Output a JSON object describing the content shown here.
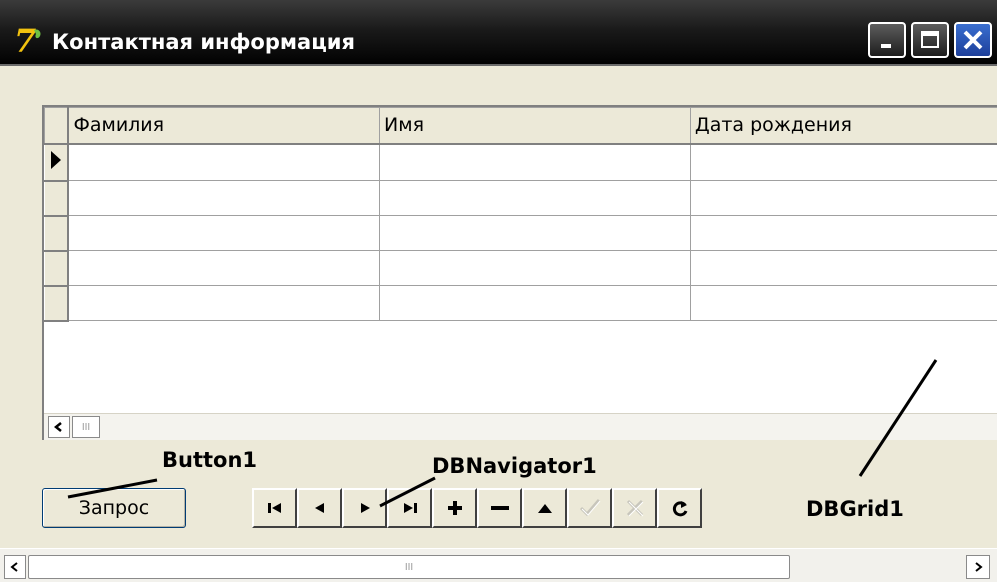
{
  "window": {
    "title": "Контактная информация"
  },
  "grid": {
    "columns": [
      "Фамилия",
      "Имя",
      "Дата рождения"
    ],
    "rows": [
      [
        "",
        "",
        ""
      ],
      [
        "",
        "",
        ""
      ],
      [
        "",
        "",
        ""
      ],
      [
        "",
        "",
        ""
      ],
      [
        "",
        "",
        ""
      ]
    ],
    "scroll_thumb": "III"
  },
  "button1": {
    "label": "Запрос"
  },
  "navigator": {
    "buttons": [
      "first-icon",
      "prior-icon",
      "next-icon",
      "last-icon",
      "insert-icon",
      "delete-icon",
      "edit-icon",
      "post-icon",
      "cancel-icon",
      "refresh-icon"
    ]
  },
  "annotations": {
    "button1": "Button1",
    "dbnavigator1": "DBNavigator1",
    "dbgrid1": "DBGrid1"
  },
  "main_scroll": {
    "thumb": "III"
  },
  "colors": {
    "titlebar": "#000000",
    "close_button": "#2a56b8",
    "face": "#ece9d8"
  }
}
